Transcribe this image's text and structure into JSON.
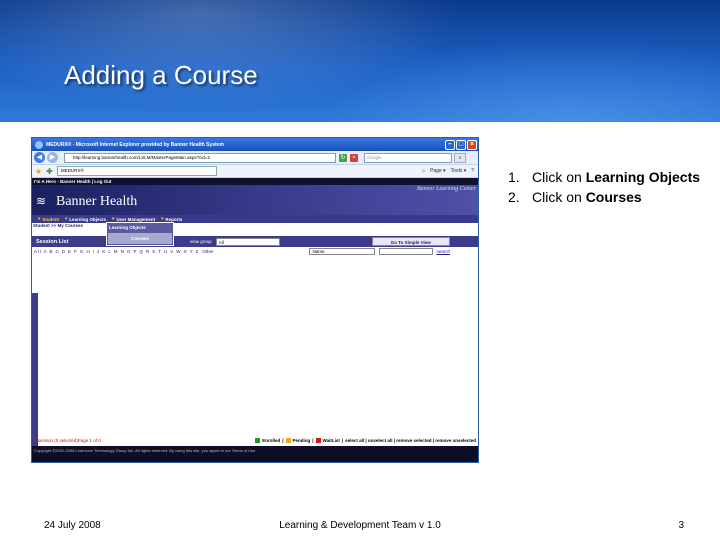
{
  "slide": {
    "title": "Adding a Course",
    "steps": [
      {
        "num": "1.",
        "prefix": "Click on ",
        "bold": "Learning Objects"
      },
      {
        "num": "2.",
        "prefix": "Click on ",
        "bold": "Courses"
      }
    ],
    "footer": {
      "date": "24 July 2008",
      "center": "Learning & Development Team v 1.0",
      "page": "3"
    }
  },
  "browser": {
    "window_title": "MEDURX® - Microsoft Internet Explorer provided by Banner Health System",
    "address": "http://learning.bannerhealth.com/LSLM/MasterPageMain.aspx?cid=2",
    "search_placeholder": "Google",
    "tab_label": "MEDURX®",
    "commands": [
      "Page ▾",
      "Tools ▾"
    ]
  },
  "page": {
    "top_nav": "I'm A Hero - Banner Health | Log Out",
    "brand": "Banner Health",
    "center_name": "Banner Learning Center",
    "menu": [
      "Student",
      "Learning Objects",
      "User Management",
      "Reports"
    ],
    "breadcrumb": "Student >> My Courses",
    "dropdown": [
      "Learning Objects",
      "Courses"
    ],
    "session_title": "Session List",
    "view_group_label": "view group",
    "view_group_value": "All",
    "simple_view_button": "Go To Simple View",
    "alphabet": "All A B C D E F G H I J K L M N O P Q R S T U V W X Y Z",
    "other": "Other",
    "name_select": "Name",
    "search_link": "search",
    "status": "0 session (0 selected)Page 1 of 0",
    "legend": [
      "Enrolled",
      "Pending",
      "WaitList"
    ],
    "legend_actions": "select all | unselect all | remove selected | remove unselected",
    "copyright": "Copyright ©2001-2008 Learncom Technology Group Inc. All rights reserved. By using this site, you agree to our Terms of Use"
  },
  "colors": {
    "header_blue": "#1e62c6",
    "banner_purple": "#3c3c8a",
    "enrolled": "#1c9a28",
    "pending": "#f0a820",
    "waitlist": "#d01818"
  }
}
